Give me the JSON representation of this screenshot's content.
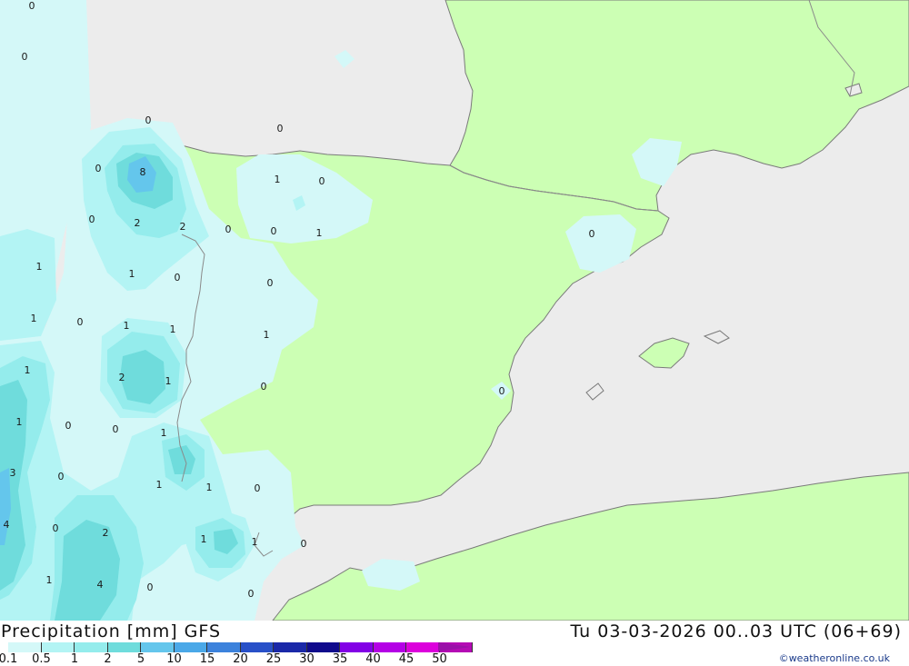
{
  "header": {
    "title": "Precipitation [mm] GFS",
    "timestamp": "Tu 03-03-2026 00..03 UTC (06+69)",
    "credit": "©weatheronline.co.uk"
  },
  "legend": {
    "labels": [
      "0.1",
      "0.5",
      "1",
      "2",
      "5",
      "10",
      "15",
      "20",
      "25",
      "30",
      "35",
      "40",
      "45",
      "50"
    ],
    "colors": [
      "#d4f8f8",
      "#b3f4f4",
      "#94ecec",
      "#6fdcdc",
      "#64c6ec",
      "#4aa8e8",
      "#3c82dc",
      "#2850c8",
      "#1a28a8",
      "#100a8c",
      "#8200e6",
      "#b400e6",
      "#dc00dc",
      "#b40ab4"
    ]
  },
  "map": {
    "colors": {
      "sea": "#ececec",
      "land": "#ccffb4",
      "border": "#8a8a8a",
      "coast": "#7a7a7a"
    },
    "precip_labels": [
      "0",
      "0",
      "0",
      "0",
      "8",
      "1",
      "0",
      "0",
      "2",
      "2",
      "0",
      "0",
      "0",
      "1",
      "1",
      "1",
      "0",
      "0",
      "1",
      "1",
      "1",
      "0",
      "1",
      "2",
      "1",
      "0",
      "1",
      "0",
      "0",
      "1",
      "3",
      "0",
      "1",
      "1",
      "0",
      "4",
      "0",
      "2",
      "1",
      "1",
      "0",
      "1",
      "4",
      "0",
      "1",
      "0",
      "0",
      "0"
    ]
  }
}
